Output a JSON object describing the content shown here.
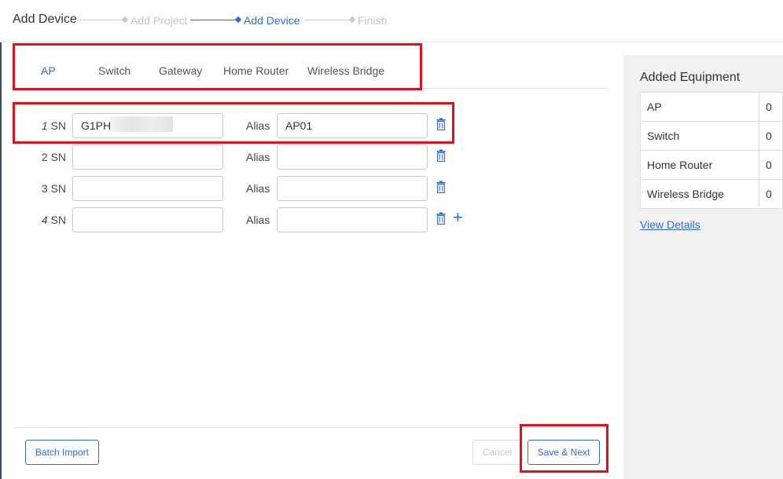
{
  "header": {
    "title": "Add Device",
    "steps": [
      {
        "label": "Add Project",
        "state": "upcoming"
      },
      {
        "label": "Add Device",
        "state": "active"
      },
      {
        "label": "Finish",
        "state": "upcoming"
      }
    ]
  },
  "tabs": [
    "AP",
    "Switch",
    "Gateway",
    "Home Router",
    "Wireless Bridge"
  ],
  "active_tab": "AP",
  "rows": [
    {
      "num": "1",
      "sn_label": "SN",
      "sn_value": "G1PH",
      "alias_label": "Alias",
      "alias_value": "AP01"
    },
    {
      "num": "2",
      "sn_label": "SN",
      "sn_value": "",
      "alias_label": "Alias",
      "alias_value": ""
    },
    {
      "num": "3",
      "sn_label": "SN",
      "sn_value": "",
      "alias_label": "Alias",
      "alias_value": ""
    },
    {
      "num": "4",
      "sn_label": "SN",
      "sn_value": "",
      "alias_label": "Alias",
      "alias_value": ""
    }
  ],
  "footer": {
    "batch_import": "Batch Import",
    "cancel": "Cancel",
    "save_next": "Save & Next"
  },
  "side": {
    "title": "Added Equipment",
    "items": [
      {
        "label": "AP",
        "count": "0"
      },
      {
        "label": "Switch",
        "count": "0"
      },
      {
        "label": "Home Router",
        "count": "0"
      },
      {
        "label": "Wireless Bridge",
        "count": "0"
      }
    ],
    "view_details": "View Details"
  },
  "colors": {
    "accent": "#2f6bd0",
    "highlight": "#e0101a",
    "panel": "#f1f1f1"
  },
  "icons": {
    "delete": "trash-icon",
    "add": "plus-icon",
    "step": "diamond-icon"
  }
}
